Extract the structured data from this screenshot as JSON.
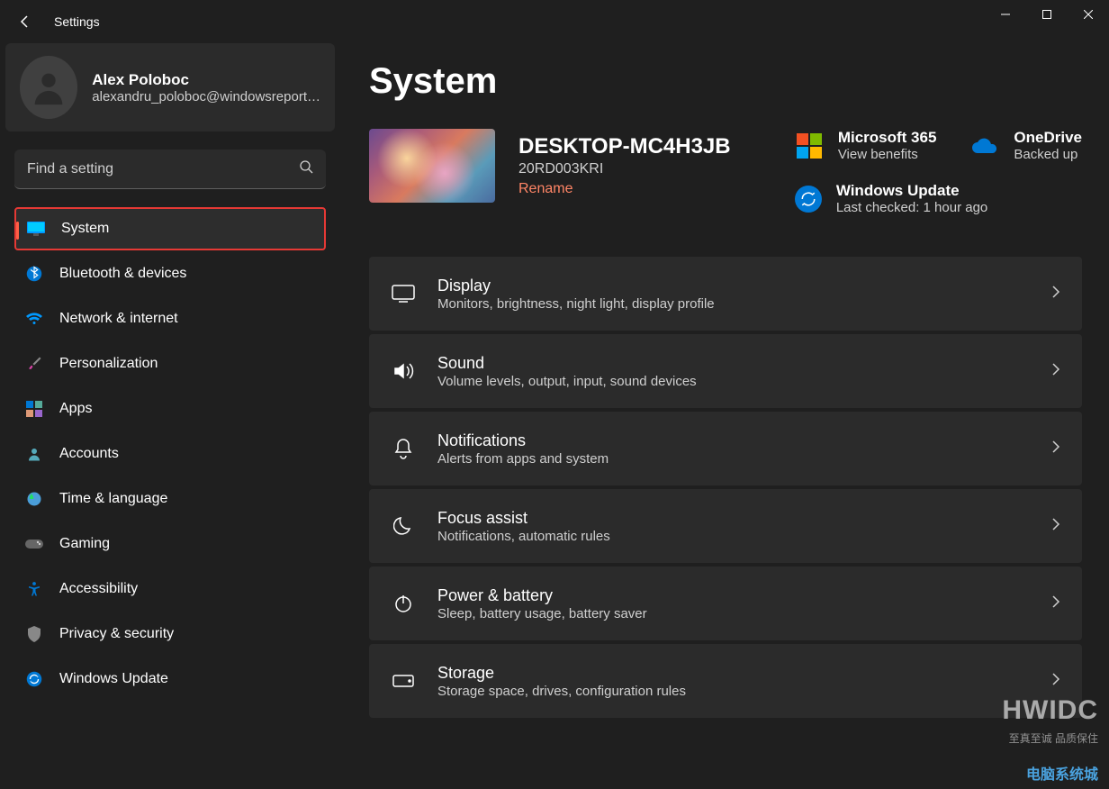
{
  "window": {
    "title": "Settings"
  },
  "profile": {
    "name": "Alex Poloboc",
    "email": "alexandru_poloboc@windowsreport…"
  },
  "search": {
    "placeholder": "Find a setting"
  },
  "nav": {
    "items": [
      {
        "label": "System",
        "icon": "monitor",
        "selected": true
      },
      {
        "label": "Bluetooth & devices",
        "icon": "bluetooth"
      },
      {
        "label": "Network & internet",
        "icon": "wifi"
      },
      {
        "label": "Personalization",
        "icon": "brush"
      },
      {
        "label": "Apps",
        "icon": "apps"
      },
      {
        "label": "Accounts",
        "icon": "person"
      },
      {
        "label": "Time & language",
        "icon": "globe"
      },
      {
        "label": "Gaming",
        "icon": "gamepad"
      },
      {
        "label": "Accessibility",
        "icon": "accessibility"
      },
      {
        "label": "Privacy & security",
        "icon": "shield"
      },
      {
        "label": "Windows Update",
        "icon": "sync"
      }
    ]
  },
  "page": {
    "title": "System"
  },
  "device": {
    "name": "DESKTOP-MC4H3JB",
    "model": "20RD003KRI",
    "rename": "Rename"
  },
  "services": {
    "ms365": {
      "title": "Microsoft 365",
      "sub": "View benefits"
    },
    "onedrive": {
      "title": "OneDrive",
      "sub": "Backed up"
    },
    "update": {
      "title": "Windows Update",
      "sub": "Last checked: 1 hour ago"
    }
  },
  "settings": [
    {
      "title": "Display",
      "sub": "Monitors, brightness, night light, display profile",
      "icon": "display"
    },
    {
      "title": "Sound",
      "sub": "Volume levels, output, input, sound devices",
      "icon": "sound"
    },
    {
      "title": "Notifications",
      "sub": "Alerts from apps and system",
      "icon": "bell"
    },
    {
      "title": "Focus assist",
      "sub": "Notifications, automatic rules",
      "icon": "moon"
    },
    {
      "title": "Power & battery",
      "sub": "Sleep, battery usage, battery saver",
      "icon": "power"
    },
    {
      "title": "Storage",
      "sub": "Storage space, drives, configuration rules",
      "icon": "storage"
    }
  ],
  "watermark": {
    "brand": "HWIDC",
    "tag": "至真至诚 品质保住",
    "site": "电脑系统城"
  }
}
